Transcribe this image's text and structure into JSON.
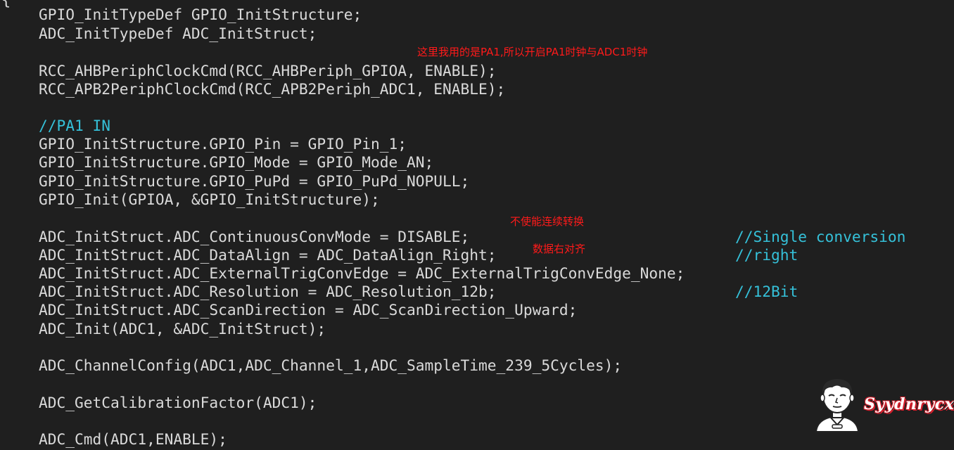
{
  "editor": {
    "open_brace": "{",
    "lines": [
      "GPIO_InitTypeDef GPIO_InitStructure;",
      "ADC_InitTypeDef ADC_InitStruct;",
      "RCC_AHBPeriphClockCmd(RCC_AHBPeriph_GPIOA, ENABLE);",
      "RCC_APB2PeriphClockCmd(RCC_APB2Periph_ADC1, ENABLE);",
      "//PA1 IN",
      "GPIO_InitStructure.GPIO_Pin = GPIO_Pin_1;",
      "GPIO_InitStructure.GPIO_Mode = GPIO_Mode_AN;",
      "GPIO_InitStructure.GPIO_PuPd = GPIO_PuPd_NOPULL;",
      "GPIO_Init(GPIOA, &GPIO_InitStructure);",
      "ADC_InitStruct.ADC_ContinuousConvMode = DISABLE;",
      "ADC_InitStruct.ADC_DataAlign = ADC_DataAlign_Right;",
      "ADC_InitStruct.ADC_ExternalTrigConvEdge = ADC_ExternalTrigConvEdge_None;",
      "ADC_InitStruct.ADC_Resolution = ADC_Resolution_12b;",
      "ADC_InitStruct.ADC_ScanDirection = ADC_ScanDirection_Upward;",
      "ADC_Init(ADC1, &ADC_InitStruct);",
      "ADC_ChannelConfig(ADC1,ADC_Channel_1,ADC_SampleTime_239_5Cycles);",
      "ADC_GetCalibrationFactor(ADC1);",
      "ADC_Cmd(ADC1,ENABLE);"
    ],
    "side_comments": {
      "continuous": "//Single conversion",
      "align": "//right",
      "resolution": "//12Bit"
    }
  },
  "annotations": {
    "clock_note": "这里我用的是PA1,所以开启PA1时钟与ADC1时钟",
    "continuous_note": "不使能连续转换",
    "align_note": "数据右对齐"
  },
  "watermark": {
    "text": "Syydnrycx"
  },
  "colors": {
    "background": "#1f1f1f",
    "code_text": "#dadada",
    "comment": "#35c1d9",
    "annotation": "#ff1a1a",
    "watermark_outline": "#d41f2c"
  }
}
